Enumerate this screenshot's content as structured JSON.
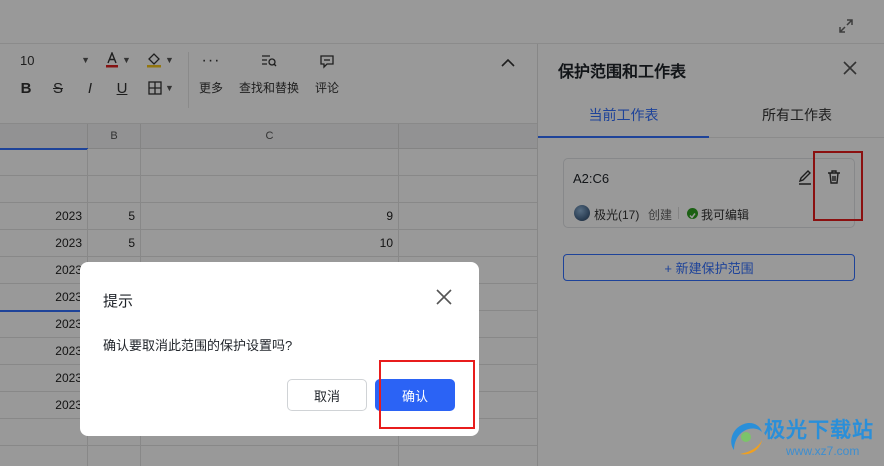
{
  "toolbar": {
    "font_size": "10",
    "more_label": "更多",
    "find_replace_label": "查找和替换",
    "comment_label": "评论"
  },
  "grid": {
    "col_b": "B",
    "col_c": "C",
    "rows": [
      {
        "a": "",
        "b": "",
        "c": ""
      },
      {
        "a": "",
        "b": "",
        "c": ""
      },
      {
        "a": "2023",
        "b": "5",
        "c": "9"
      },
      {
        "a": "2023",
        "b": "5",
        "c": "10"
      },
      {
        "a": "2023",
        "b": "",
        "c": ""
      },
      {
        "a": "2023",
        "b": "",
        "c": ""
      },
      {
        "a": "2023",
        "b": "",
        "c": ""
      },
      {
        "a": "2023",
        "b": "",
        "c": ""
      },
      {
        "a": "2023",
        "b": "",
        "c": ""
      },
      {
        "a": "2023",
        "b": "",
        "c": ""
      }
    ]
  },
  "panel": {
    "title": "保护范围和工作表",
    "tab_current": "当前工作表",
    "tab_all": "所有工作表",
    "range": {
      "name": "A2:C6",
      "creator": "极光(17)",
      "created": "创建",
      "permission": "我可编辑"
    },
    "new_range": "+ 新建保护范围"
  },
  "dialog": {
    "title": "提示",
    "message": "确认要取消此范围的保护设置吗?",
    "cancel": "取消",
    "confirm": "确认"
  },
  "watermark": {
    "text": "极光下载站",
    "url": "www.xz7.com"
  },
  "colors": {
    "accent": "#3370ff",
    "primary_button": "#2b63f5",
    "highlight_box": "#e81c1c",
    "success": "#2ea121"
  }
}
